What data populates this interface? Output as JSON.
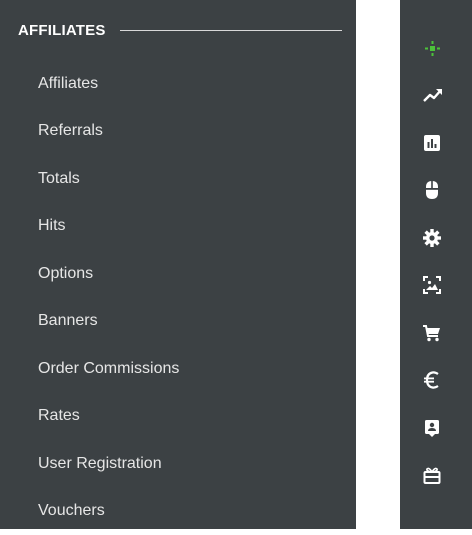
{
  "sidebar": {
    "section_title": "AFFILIATES",
    "items": [
      {
        "label": "Affiliates"
      },
      {
        "label": "Referrals"
      },
      {
        "label": "Totals"
      },
      {
        "label": "Hits"
      },
      {
        "label": "Options"
      },
      {
        "label": "Banners"
      },
      {
        "label": "Order Commissions"
      },
      {
        "label": "Rates"
      },
      {
        "label": "User Registration"
      },
      {
        "label": "Vouchers"
      }
    ]
  },
  "icon_bar": {
    "icons": [
      {
        "name": "affiliates-icon",
        "color": "#4cc23a"
      },
      {
        "name": "trend-icon",
        "color": "#ffffff"
      },
      {
        "name": "bar-chart-icon",
        "color": "#ffffff"
      },
      {
        "name": "mouse-icon",
        "color": "#ffffff"
      },
      {
        "name": "gear-icon",
        "color": "#ffffff"
      },
      {
        "name": "image-icon",
        "color": "#ffffff"
      },
      {
        "name": "cart-icon",
        "color": "#ffffff"
      },
      {
        "name": "euro-icon",
        "color": "#ffffff"
      },
      {
        "name": "user-badge-icon",
        "color": "#ffffff"
      },
      {
        "name": "gift-icon",
        "color": "#ffffff"
      }
    ]
  },
  "colors": {
    "panel_bg": "#3c4144",
    "text": "#e6e6e6",
    "accent": "#4cc23a"
  }
}
